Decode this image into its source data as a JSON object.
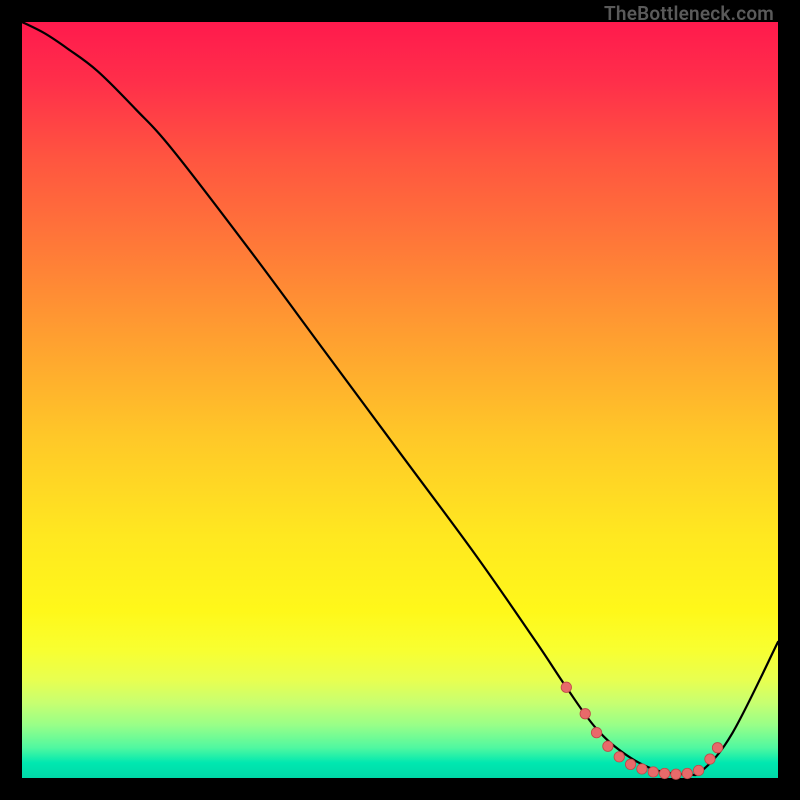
{
  "watermark": "TheBottleneck.com",
  "colors": {
    "curve": "#000000",
    "point_fill": "#e86a6a",
    "point_stroke": "#c04848"
  },
  "chart_data": {
    "type": "line",
    "title": "",
    "xlabel": "",
    "ylabel": "",
    "xlim": [
      0,
      1
    ],
    "ylim": [
      0,
      1
    ],
    "x": [
      0.0,
      0.03,
      0.06,
      0.1,
      0.15,
      0.2,
      0.3,
      0.4,
      0.5,
      0.6,
      0.68,
      0.72,
      0.76,
      0.8,
      0.84,
      0.88,
      0.9,
      0.94,
      1.0
    ],
    "values": [
      1.0,
      0.985,
      0.965,
      0.935,
      0.885,
      0.83,
      0.7,
      0.565,
      0.43,
      0.295,
      0.18,
      0.12,
      0.065,
      0.03,
      0.01,
      0.005,
      0.01,
      0.06,
      0.18
    ],
    "highlight_points": [
      {
        "x": 0.72,
        "y": 0.12
      },
      {
        "x": 0.745,
        "y": 0.085
      },
      {
        "x": 0.76,
        "y": 0.06
      },
      {
        "x": 0.775,
        "y": 0.042
      },
      {
        "x": 0.79,
        "y": 0.028
      },
      {
        "x": 0.805,
        "y": 0.018
      },
      {
        "x": 0.82,
        "y": 0.012
      },
      {
        "x": 0.835,
        "y": 0.008
      },
      {
        "x": 0.85,
        "y": 0.006
      },
      {
        "x": 0.865,
        "y": 0.005
      },
      {
        "x": 0.88,
        "y": 0.006
      },
      {
        "x": 0.895,
        "y": 0.01
      },
      {
        "x": 0.91,
        "y": 0.025
      },
      {
        "x": 0.92,
        "y": 0.04
      }
    ]
  }
}
